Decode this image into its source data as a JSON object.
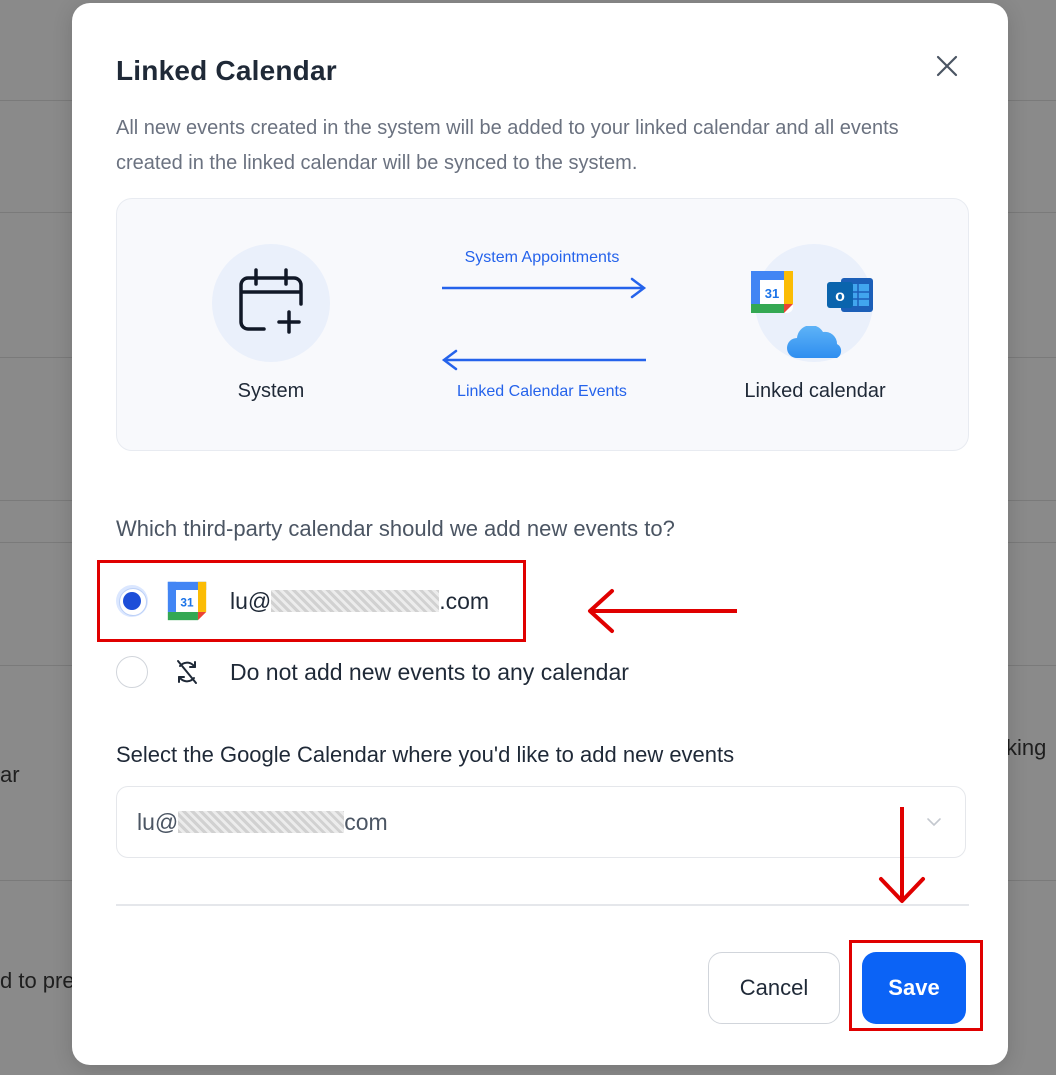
{
  "background": {
    "fragments": [
      "king",
      "ar",
      "d to pre"
    ]
  },
  "modal": {
    "title": "Linked Calendar",
    "description": "All new events created in the system will be added to your linked calendar and all events created in the linked calendar will be synced to the system.",
    "diagram": {
      "system_label": "System",
      "linked_label": "Linked calendar",
      "arrow_right_label": "System Appointments",
      "arrow_left_label": "Linked Calendar Events",
      "icons": [
        "calendar-plus-icon",
        "google-calendar-icon",
        "outlook-icon",
        "icloud-icon"
      ]
    },
    "question": "Which third-party calendar should we add new events to?",
    "options": [
      {
        "prefix": "lu@",
        "suffix": ".com",
        "selected": true,
        "icon": "google-calendar-icon"
      },
      {
        "label": "Do not add new events to any calendar",
        "selected": false,
        "icon": "sync-disabled-icon"
      }
    ],
    "select_label": "Select the Google Calendar where you'd like to add new events",
    "select_value_prefix": "lu@",
    "select_value_suffix": "com",
    "cancel_label": "Cancel",
    "save_label": "Save",
    "google_calendar_day": "31",
    "outlook_letter": "o"
  },
  "colors": {
    "accent": "#0b63f6",
    "annotation": "#e00000"
  }
}
